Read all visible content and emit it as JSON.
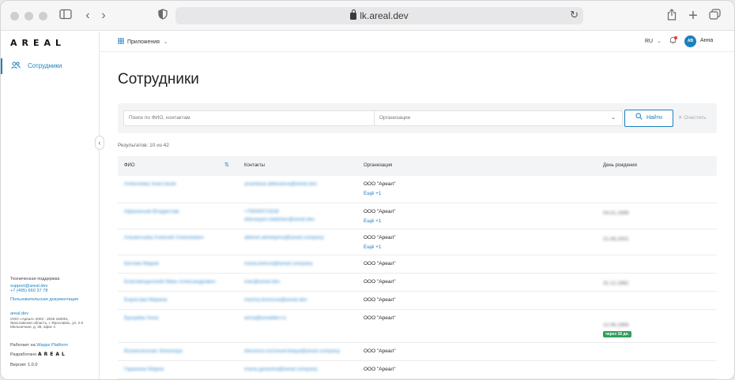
{
  "browser": {
    "url": "lk.areal.dev"
  },
  "sidebar": {
    "logo": "AREAL",
    "nav": [
      {
        "label": "Сотрудники",
        "icon": "users-icon",
        "active": true
      }
    ],
    "support_title": "Техническая поддержка",
    "support_email": "support@areal.dev",
    "support_phone": "+7 (495) 660 37 78",
    "user_docs": "Пользовательская документация",
    "site": "areal.dev",
    "legal_1": "ООО «Ареал» 2003 - 2025 150001,",
    "legal_2": "Ярославская область, г. Ярославль, ул. 2-я",
    "legal_3": "Мельничная, д. 36, офис 4",
    "powered_prefix": "Работает на",
    "powered_link": "Wapps Platform",
    "developed_by": "Разработано",
    "developed_logo": "AREAL",
    "version": "Версия: 1.0.0"
  },
  "topbar": {
    "apps_label": "Приложения",
    "lang": "RU",
    "avatar_initials": "АВ",
    "user_name": "Анна"
  },
  "page": {
    "title": "Сотрудники",
    "search_placeholder": "Поиск по ФИО, контактам",
    "org_placeholder": "Организации",
    "find_button": "Найти",
    "clear_button": "Очистить",
    "results": "Результатов: 10 из 42"
  },
  "table": {
    "headers": [
      "ФИО",
      "Контакты",
      "Организация",
      "День рождения"
    ],
    "rows": [
      {
        "name": "Алексеева Анастасия",
        "contact1": "anastasia.alekseeva@areal.dev",
        "contact2": "",
        "org": "ООО \"Ареал\"",
        "more": "Ещё +1",
        "birthday": "",
        "badge": ""
      },
      {
        "name": "Афанасьев Владислав",
        "contact1": "+79000071638",
        "contact2": "afanasyev.vladislav@areal.dev",
        "org": "ООО \"Ареал\"",
        "more": "Ещё +1",
        "birthday": "04.01.1999",
        "badge": ""
      },
      {
        "name": "Альметьева Алексей Алексеевич",
        "contact1": "aleksei.almetyeva@areal.company",
        "contact2": "",
        "org": "ООО \"Ареал\"",
        "more": "Ещё +1",
        "birthday": "21.06.2001",
        "badge": ""
      },
      {
        "name": "Белова Мария",
        "contact1": "maria.belova@areal.company",
        "contact2": "",
        "org": "ООО \"Ареал\"",
        "more": "",
        "birthday": "",
        "badge": ""
      },
      {
        "name": "Благовещенский Иван Александрович",
        "contact1": "ivan@areal.dev",
        "contact2": "",
        "org": "ООО \"Ареал\"",
        "more": "",
        "birthday": "31.12.1982",
        "badge": ""
      },
      {
        "name": "Борисова Марина",
        "contact1": "marina.borisova@areal.dev",
        "contact2": "",
        "org": "ООО \"Ареал\"",
        "more": "",
        "birthday": "",
        "badge": ""
      },
      {
        "name": "Бушуева Анна",
        "contact1": "anna@arealdev.ru",
        "contact2": "",
        "org": "ООО \"Ареал\"",
        "more": "",
        "birthday": "12.06.1994",
        "badge": "через 18 дн."
      },
      {
        "name": "Вознесенская Элеонора",
        "contact1": "eleonora.voznesenskaya@areal.company",
        "contact2": "",
        "org": "ООО \"Ареал\"",
        "more": "",
        "birthday": "",
        "badge": ""
      },
      {
        "name": "Гаранина Мария",
        "contact1": "maria.garanina@areal.company",
        "contact2": "",
        "org": "ООО \"Ареал\"",
        "more": "",
        "birthday": "",
        "badge": ""
      }
    ]
  }
}
